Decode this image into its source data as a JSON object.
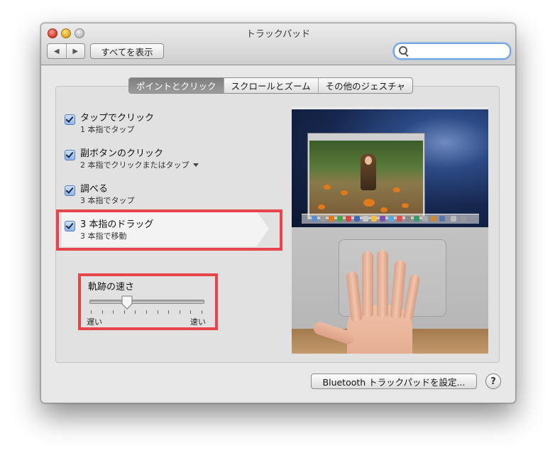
{
  "window": {
    "title": "トラックパッド"
  },
  "toolbar": {
    "back_glyph": "◀",
    "forward_glyph": "▶",
    "show_all": "すべてを表示",
    "search_placeholder": ""
  },
  "tabs": [
    {
      "label": "ポイントとクリック",
      "active": true
    },
    {
      "label": "スクロールとズーム",
      "active": false
    },
    {
      "label": "その他のジェスチャ",
      "active": false
    }
  ],
  "options": [
    {
      "title": "タップでクリック",
      "subtitle": "1 本指でタップ",
      "checked": true
    },
    {
      "title": "副ボタンのクリック",
      "subtitle": "2 本指でクリックまたはタップ",
      "checked": true
    },
    {
      "title": "調べる",
      "subtitle": "3 本指でタップ",
      "checked": true
    },
    {
      "title": "3 本指のドラッグ",
      "subtitle": "3 本指で移動",
      "checked": true
    }
  ],
  "tracking_speed": {
    "label": "軌跡の速さ",
    "min_label": "遅い",
    "max_label": "速い",
    "value_fraction": 0.33
  },
  "bluetooth_button": "Bluetooth トラックパッドを設定...",
  "help_label": "?",
  "colors": {
    "highlight_border": "#e8454a",
    "active_tab": "#8a8a8a",
    "search_focus": "#6ea6e6"
  },
  "icons": [
    "search-icon",
    "back-arrow-icon",
    "forward-arrow-icon",
    "checkbox-icon",
    "popup-arrow-icon",
    "slider-thumb-icon",
    "help-icon"
  ]
}
